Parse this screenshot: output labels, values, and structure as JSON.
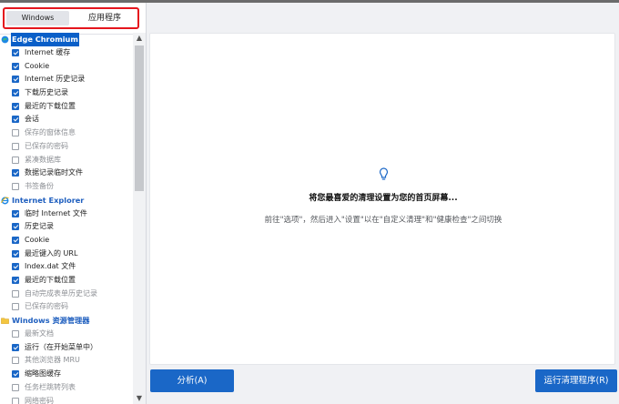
{
  "tabs": [
    {
      "label": "Windows",
      "active": true
    },
    {
      "label": "应用程序",
      "active": false
    }
  ],
  "tree": [
    {
      "group": "Edge Chromium",
      "icon": "edge-icon",
      "selected": true,
      "items": [
        {
          "label": "Internet 缓存",
          "checked": true
        },
        {
          "label": "Cookie",
          "checked": true
        },
        {
          "label": "Internet 历史记录",
          "checked": true
        },
        {
          "label": "下载历史记录",
          "checked": true
        },
        {
          "label": "最近的下载位置",
          "checked": true
        },
        {
          "label": "会话",
          "checked": true
        },
        {
          "label": "保存的窗体信息",
          "checked": false
        },
        {
          "label": "已保存的密码",
          "checked": false
        },
        {
          "label": "紧凑数据库",
          "checked": false
        },
        {
          "label": "数据记录临时文件",
          "checked": true
        },
        {
          "label": "书签备份",
          "checked": false
        }
      ]
    },
    {
      "group": "Internet Explorer",
      "icon": "internet-explorer-icon",
      "selected": false,
      "items": [
        {
          "label": "临时 Internet 文件",
          "checked": true
        },
        {
          "label": "历史记录",
          "checked": true
        },
        {
          "label": "Cookie",
          "checked": true
        },
        {
          "label": "最近键入的 URL",
          "checked": true
        },
        {
          "label": "Index.dat 文件",
          "checked": true
        },
        {
          "label": "最近的下载位置",
          "checked": true
        },
        {
          "label": "自动完成表单历史记录",
          "checked": false
        },
        {
          "label": "已保存的密码",
          "checked": false
        }
      ]
    },
    {
      "group": "Windows 资源管理器",
      "icon": "folder-icon",
      "selected": false,
      "items": [
        {
          "label": "最新文档",
          "checked": false
        },
        {
          "label": "运行（在开始菜单中）",
          "checked": true
        },
        {
          "label": "其他浏览器 MRU",
          "checked": false
        },
        {
          "label": "缩略图缓存",
          "checked": true
        },
        {
          "label": "任务栏跳转列表",
          "checked": false
        },
        {
          "label": "网络密码",
          "checked": false
        }
      ]
    }
  ],
  "main": {
    "headline": "将您最喜爱的清理设置为您的首页屏幕...",
    "subtitle": "前往\"选项\"，然后进入\"设置\"以在\"自定义清理\"和\"健康检查\"之间切换"
  },
  "buttons": {
    "analyze": "分析(A)",
    "run": "运行清理程序(R)"
  },
  "colors": {
    "accent": "#1a67c7",
    "highlight_border": "#e5161d"
  }
}
